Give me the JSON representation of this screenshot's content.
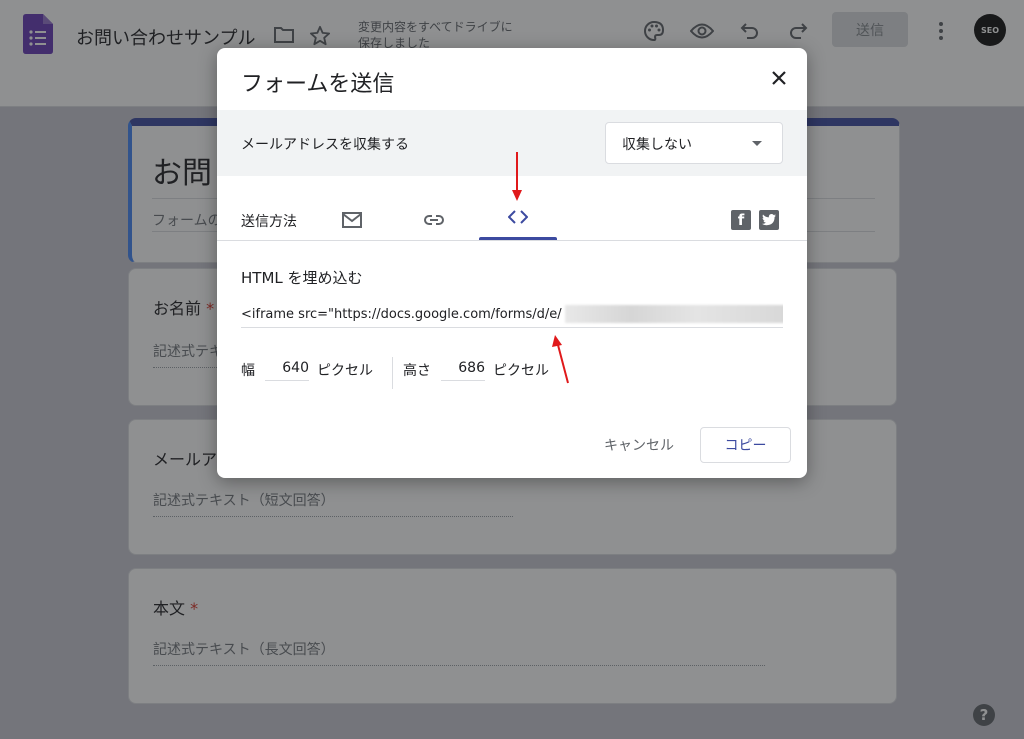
{
  "header": {
    "title": "お問い合わせサンプル",
    "save_status": "変更内容をすべてドライブに保存しました",
    "send_label": "送信",
    "avatar_text": "SEO"
  },
  "form": {
    "title_partial": "お問",
    "desc_partial": "フォームの",
    "questions": [
      {
        "label": "お名前",
        "required": "*",
        "hint": "記述式テキ"
      },
      {
        "label": "メールア",
        "hint": "記述式テキスト（短文回答）"
      },
      {
        "label": "本文",
        "required": "*",
        "hint": "記述式テキスト（長文回答）"
      }
    ]
  },
  "dialog": {
    "title": "フォームを送信",
    "collect_email_label": "メールアドレスを収集する",
    "collect_email_value": "収集しない",
    "send_via_label": "送信方法",
    "active_tab": "embed",
    "section_title": "HTML を埋め込む",
    "embed_code": "<iframe src=\"https://docs.google.com/forms/d/e/",
    "width_label": "幅",
    "width_value": "640",
    "width_unit": "ピクセル",
    "height_label": "高さ",
    "height_value": "686",
    "height_unit": "ピクセル",
    "cancel_label": "キャンセル",
    "copy_label": "コピー"
  },
  "colors": {
    "accent": "#3c4aa0",
    "forms_purple": "#673ab7",
    "annotation_red": "#e0191b"
  }
}
